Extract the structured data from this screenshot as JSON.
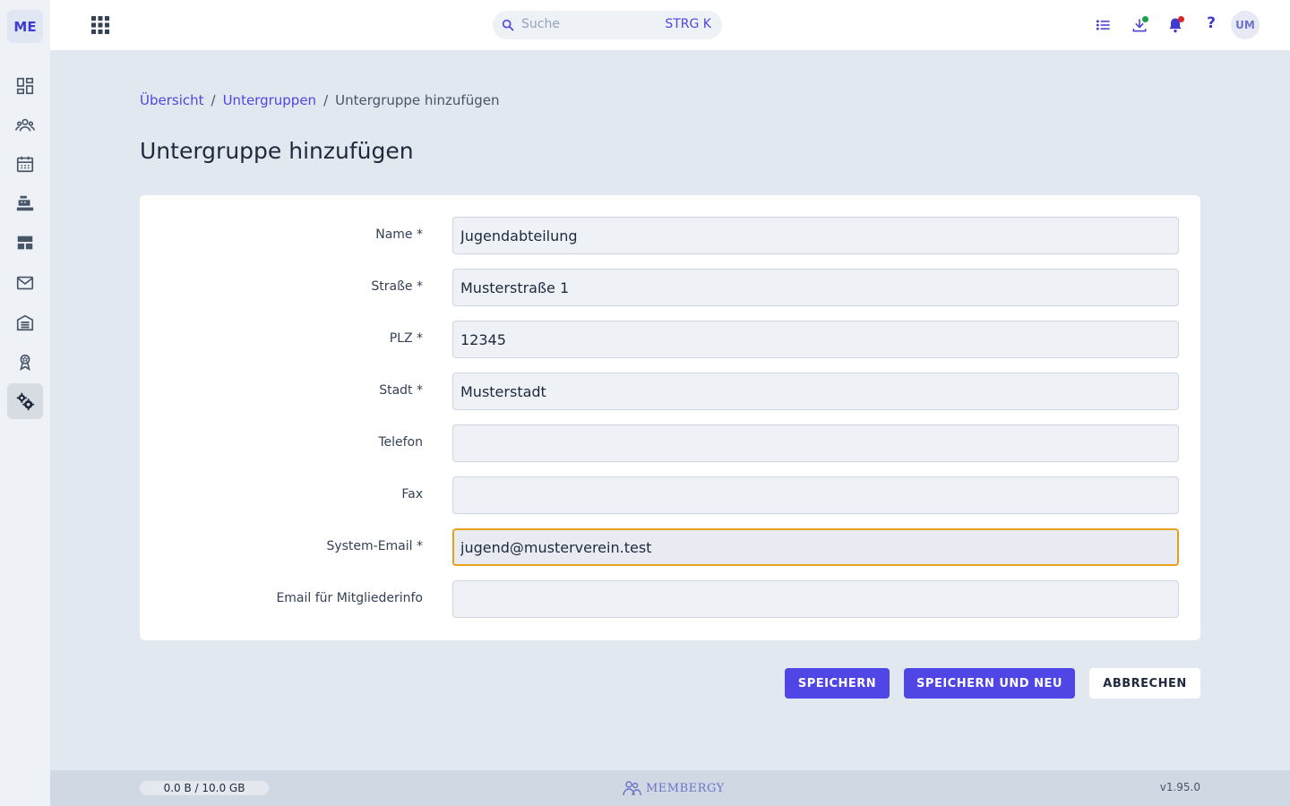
{
  "sidebar": {
    "logo": "ME",
    "items": [
      {
        "icon": "dashboard-icon"
      },
      {
        "icon": "members-icon"
      },
      {
        "icon": "calendar-icon"
      },
      {
        "icon": "cash-register-icon"
      },
      {
        "icon": "layout-icon"
      },
      {
        "icon": "mail-icon"
      },
      {
        "icon": "warehouse-icon"
      },
      {
        "icon": "award-icon"
      },
      {
        "icon": "settings-icon",
        "active": true
      }
    ]
  },
  "topbar": {
    "search_placeholder": "Suche",
    "search_shortcut": "STRG K",
    "help_label": "?",
    "avatar_initials": "UM"
  },
  "breadcrumb": {
    "items": [
      "Übersicht",
      "Untergruppen"
    ],
    "current": "Untergruppe hinzufügen",
    "separator": "/"
  },
  "page_title": "Untergruppe hinzufügen",
  "form": {
    "fields": [
      {
        "label": "Name *",
        "value": "Jugendabteilung"
      },
      {
        "label": "Straße *",
        "value": "Musterstraße 1"
      },
      {
        "label": "PLZ *",
        "value": "12345"
      },
      {
        "label": "Stadt *",
        "value": "Musterstadt"
      },
      {
        "label": "Telefon",
        "value": ""
      },
      {
        "label": "Fax",
        "value": ""
      },
      {
        "label": "System-Email *",
        "value": "jugend@musterverein.test"
      },
      {
        "label": "Email für Mitgliederinfo",
        "value": ""
      }
    ]
  },
  "buttons": {
    "save": "SPEICHERN",
    "save_new": "SPEICHERN UND NEU",
    "cancel": "ABBRECHEN"
  },
  "footer": {
    "storage": "0.0 B / 10.0 GB",
    "brand": "MEMBERGY",
    "version": "v1.95.0"
  },
  "colors": {
    "accent": "#4f46e5",
    "focus_border": "#e5a11c",
    "notification_red": "#dc2626",
    "download_green": "#16a34a"
  }
}
